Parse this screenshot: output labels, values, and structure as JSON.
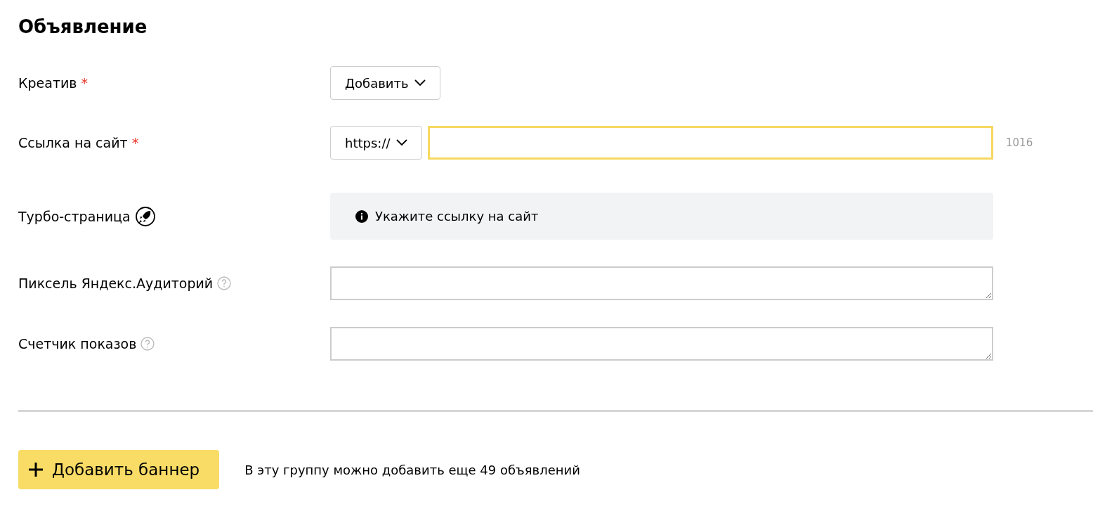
{
  "title": "Объявление",
  "rows": [
    {
      "kind": "dropdown",
      "label": "Креатив",
      "required_mark": "*",
      "button": "Добавить"
    },
    {
      "kind": "url",
      "label": "Ссылка на сайт",
      "required_mark": "*",
      "protocol": "https://",
      "focused": true,
      "counter": "1016"
    },
    {
      "kind": "notice",
      "label": "Турбо-страница",
      "turbo_icon": true,
      "notice": "Укажите ссылку на сайт"
    },
    {
      "kind": "textarea",
      "label": "Пиксель Яндекс.Аудиторий",
      "help_icon": true
    },
    {
      "kind": "textarea",
      "label": "Счетчик показов",
      "help_icon": true
    }
  ],
  "footer": {
    "add_button": "Добавить баннер",
    "note": "В эту группу можно добавить еще 49 объявлений"
  }
}
